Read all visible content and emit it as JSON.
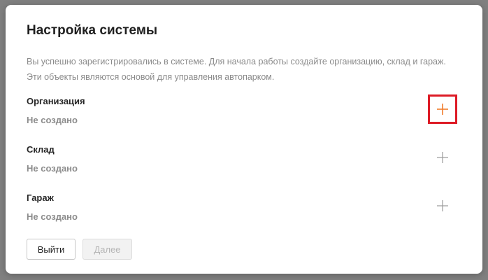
{
  "dialog": {
    "title": "Настройка системы",
    "description": "Вы успешно зарегистрировались в системе. Для начала работы создайте организацию, склад и гараж. Эти объекты являются основой для управления автопарком."
  },
  "sections": [
    {
      "title": "Организация",
      "status": "Не создано",
      "add_icon": "plus-icon",
      "add_icon_color": "#f07c2c",
      "highlighted": true
    },
    {
      "title": "Склад",
      "status": "Не создано",
      "add_icon": "plus-icon",
      "add_icon_color": "#9a9a9a",
      "highlighted": false
    },
    {
      "title": "Гараж",
      "status": "Не создано",
      "add_icon": "plus-icon",
      "add_icon_color": "#9a9a9a",
      "highlighted": false
    }
  ],
  "footer": {
    "exit_label": "Выйти",
    "next_label": "Далее",
    "next_disabled": true
  },
  "colors": {
    "highlight_border": "#dd1b26",
    "accent_orange": "#f07c2c"
  }
}
